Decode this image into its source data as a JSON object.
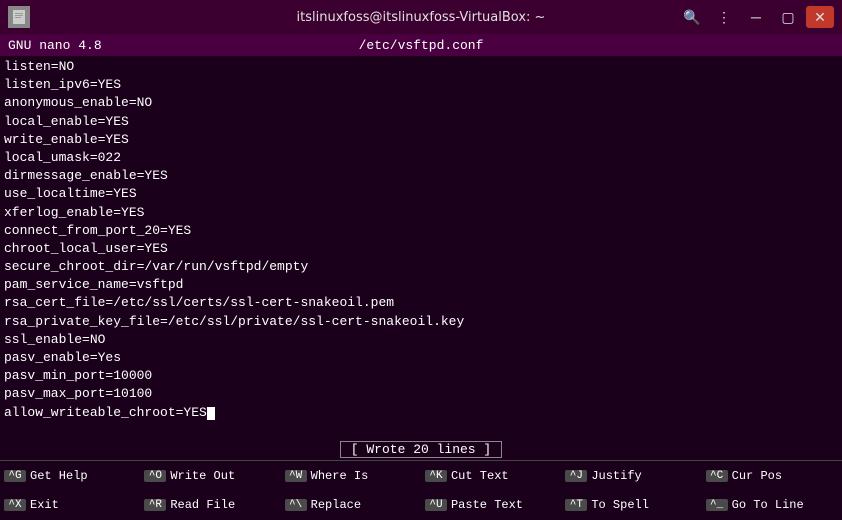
{
  "titlebar": {
    "title": "itslinuxfoss@itslinuxfoss-VirtualBox: ~",
    "app_icon": "📄"
  },
  "nano": {
    "topbar_left": "GNU nano 4.8",
    "topbar_file": "/etc/vsftpd.conf"
  },
  "editor": {
    "lines": [
      "listen=NO",
      "listen_ipv6=YES",
      "anonymous_enable=NO",
      "local_enable=YES",
      "write_enable=YES",
      "local_umask=022",
      "dirmessage_enable=YES",
      "use_localtime=YES",
      "xferlog_enable=YES",
      "connect_from_port_20=YES",
      "chroot_local_user=YES",
      "secure_chroot_dir=/var/run/vsftpd/empty",
      "pam_service_name=vsftpd",
      "rsa_cert_file=/etc/ssl/certs/ssl-cert-snakeoil.pem",
      "rsa_private_key_file=/etc/ssl/private/ssl-cert-snakeoil.key",
      "ssl_enable=NO",
      "pasv_enable=Yes",
      "pasv_min_port=10000",
      "pasv_max_port=10100",
      "allow_writeable_chroot=YES"
    ],
    "cursor_line_index": 19
  },
  "status": {
    "message": "[ Wrote 20 lines ]"
  },
  "shortcuts": [
    {
      "key": "^G",
      "label": "Get Help"
    },
    {
      "key": "^O",
      "label": "Write Out"
    },
    {
      "key": "^W",
      "label": "Where Is"
    },
    {
      "key": "^K",
      "label": "Cut Text"
    },
    {
      "key": "^J",
      "label": "Justify"
    },
    {
      "key": "^C",
      "label": "Cur Pos"
    },
    {
      "key": "^X",
      "label": "Exit"
    },
    {
      "key": "^R",
      "label": "Read File"
    },
    {
      "key": "^\\",
      "label": "Replace"
    },
    {
      "key": "^U",
      "label": "Paste Text"
    },
    {
      "key": "^T",
      "label": "To Spell"
    },
    {
      "key": "^_",
      "label": "Go To Line"
    }
  ]
}
